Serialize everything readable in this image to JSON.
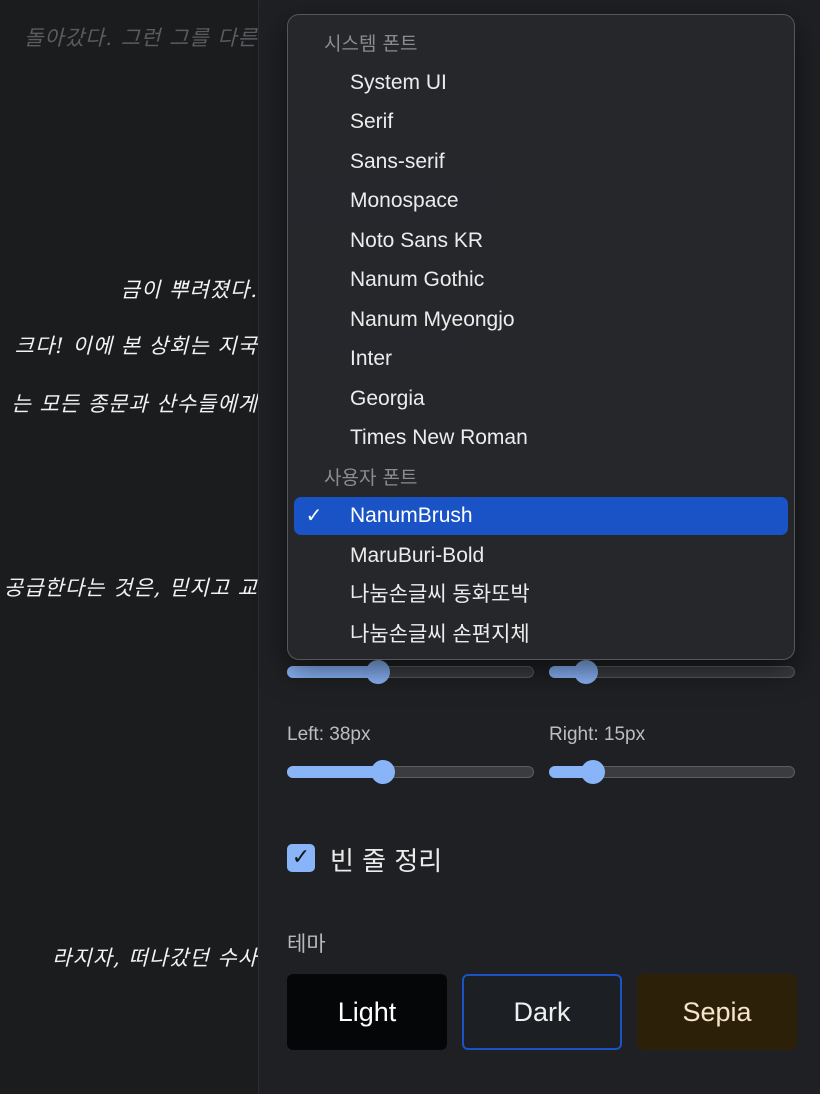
{
  "reader": {
    "lines": [
      "돌아갔다. 그런 그를 다른",
      "금이 뿌려졌다.",
      "크다! 이에 본 상회는 지국",
      "는 모든 종문과 산수들에게",
      "공급한다는 것은, 믿지고 교",
      "라지자, 떠나갔던 수사"
    ]
  },
  "font_dropdown": {
    "groups": [
      {
        "header": "시스템 폰트",
        "options": [
          "System UI",
          "Serif",
          "Sans-serif",
          "Monospace",
          "Noto Sans KR",
          "Nanum Gothic",
          "Nanum Myeongjo",
          "Inter",
          "Georgia",
          "Times New Roman"
        ]
      },
      {
        "header": "사용자 폰트",
        "options": [
          "NanumBrush",
          "MaruBuri-Bold",
          "나눔손글씨 동화또박",
          "나눔손글씨 손편지체"
        ]
      }
    ],
    "selected": "NanumBrush",
    "check_glyph": "✓"
  },
  "sliders": {
    "top_left_value": 0.37,
    "top_right_value": 0.15,
    "left_label": "Left: 38px",
    "left_value": 0.39,
    "right_label": "Right: 15px",
    "right_value": 0.18
  },
  "checkbox": {
    "label": "빈 줄 정리",
    "checked": true,
    "glyph": "✓"
  },
  "theme": {
    "label": "테마",
    "options": [
      "Light",
      "Dark",
      "Sepia"
    ],
    "selected": "Dark"
  },
  "colors": {
    "accent": "#1a53c5",
    "slider": "#8ab4f8",
    "background": "#1e2023"
  }
}
